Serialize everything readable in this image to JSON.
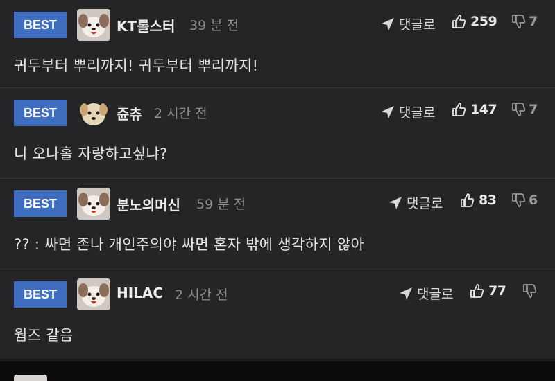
{
  "comments": [
    {
      "badge": "BEST",
      "username": "KT롤스터",
      "time": "39 분 전",
      "reply_label": "댓글로",
      "likes": "259",
      "dislikes": "7",
      "text": "귀두부터 뿌리까지! 귀두부터 뿌리까지!"
    },
    {
      "badge": "BEST",
      "username": "쥰츄",
      "time": "2 시간 전",
      "reply_label": "댓글로",
      "likes": "147",
      "dislikes": "7",
      "text": "니 오나홀 자랑하고싶냐?"
    },
    {
      "badge": "BEST",
      "username": "분노의머신",
      "time": "59 분 전",
      "reply_label": "댓글로",
      "likes": "83",
      "dislikes": "6",
      "text": "?? : 싸면 존나 개인주의야 싸면 혼자 밖에 생각하지 않아"
    },
    {
      "badge": "BEST",
      "username": "HILAC",
      "time": "2 시간 전",
      "reply_label": "댓글로",
      "likes": "77",
      "dislikes": "",
      "text": "웜즈 같음"
    }
  ],
  "colors": {
    "badge_bg": "#3f6ec0",
    "background": "#252527",
    "divider": "#3a3a3c"
  },
  "icons": {
    "reply": "paper-plane-icon",
    "like": "thumbs-up-icon",
    "dislike": "thumbs-down-icon"
  }
}
